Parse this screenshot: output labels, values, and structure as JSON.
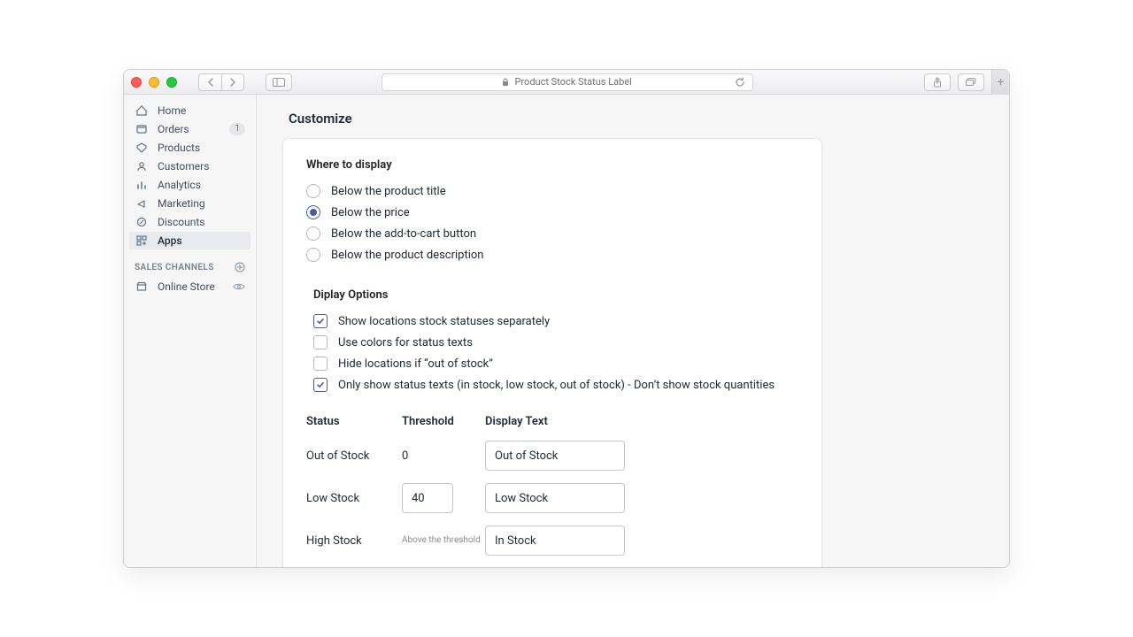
{
  "browser": {
    "page_title": "Product Stock Status Label"
  },
  "sidebar": {
    "items": [
      {
        "label": "Home"
      },
      {
        "label": "Orders",
        "badge": "1"
      },
      {
        "label": "Products"
      },
      {
        "label": "Customers"
      },
      {
        "label": "Analytics"
      },
      {
        "label": "Marketing"
      },
      {
        "label": "Discounts"
      },
      {
        "label": "Apps",
        "active": true
      }
    ],
    "section_label": "SALES CHANNELS",
    "channel": {
      "label": "Online Store"
    }
  },
  "page": {
    "title": "Customize",
    "where_title": "Where to display",
    "radios": [
      {
        "label": "Below the product title",
        "checked": false
      },
      {
        "label": "Below the price",
        "checked": true
      },
      {
        "label": "Below the add-to-cart button",
        "checked": false
      },
      {
        "label": "Below the product description",
        "checked": false
      }
    ],
    "display_title": "Diplay Options",
    "checks": [
      {
        "label": "Show locations stock statuses separately",
        "checked": true
      },
      {
        "label": "Use colors for status texts",
        "checked": false
      },
      {
        "label": "Hide locations if “out of stock”",
        "checked": false
      },
      {
        "label": "Only show status texts (in stock, low stock, out of stock) - Don’t show stock quantities",
        "checked": true
      }
    ],
    "table": {
      "headers": {
        "status": "Status",
        "threshold": "Threshold",
        "display": "Display Text"
      },
      "rows": [
        {
          "status": "Out of Stock",
          "threshold": "0",
          "threshold_editable": false,
          "display": "Out of Stock"
        },
        {
          "status": "Low Stock",
          "threshold": "40",
          "threshold_editable": true,
          "display": "Low Stock"
        },
        {
          "status": "High Stock",
          "threshold_hint": "Above the threshold",
          "display": "In Stock"
        }
      ]
    }
  }
}
